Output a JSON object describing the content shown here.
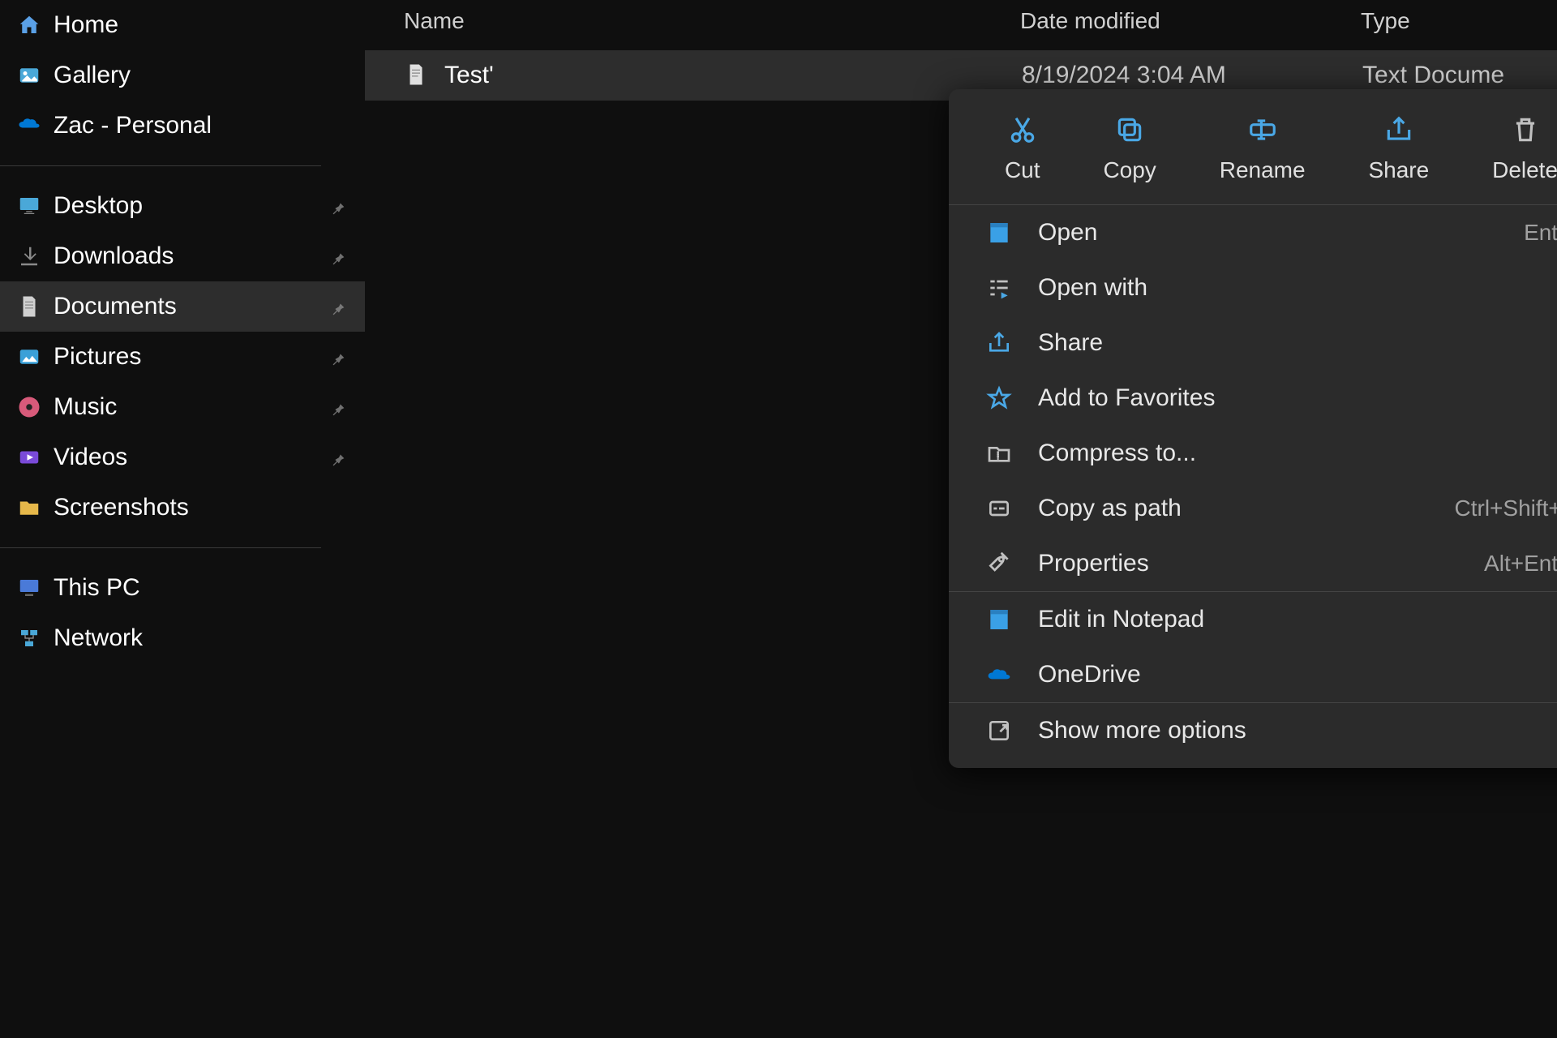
{
  "sidebar": {
    "top": [
      {
        "label": "Home",
        "icon": "home"
      },
      {
        "label": "Gallery",
        "icon": "gallery"
      },
      {
        "label": "Zac - Personal",
        "icon": "onedrive"
      }
    ],
    "pinned": [
      {
        "label": "Desktop",
        "icon": "desktop"
      },
      {
        "label": "Downloads",
        "icon": "downloads"
      },
      {
        "label": "Documents",
        "icon": "documents",
        "active": true
      },
      {
        "label": "Pictures",
        "icon": "pictures"
      },
      {
        "label": "Music",
        "icon": "music"
      },
      {
        "label": "Videos",
        "icon": "videos"
      },
      {
        "label": "Screenshots",
        "icon": "folder"
      }
    ],
    "bottom": [
      {
        "label": "This PC",
        "icon": "pc"
      },
      {
        "label": "Network",
        "icon": "network"
      }
    ]
  },
  "columns": {
    "name": "Name",
    "date": "Date modified",
    "type": "Type"
  },
  "file": {
    "name": "Test'",
    "date": "8/19/2024 3:04 AM",
    "type": "Text Docume"
  },
  "context": {
    "toolbar": [
      {
        "label": "Cut",
        "icon": "cut"
      },
      {
        "label": "Copy",
        "icon": "copy"
      },
      {
        "label": "Rename",
        "icon": "rename"
      },
      {
        "label": "Share",
        "icon": "share"
      },
      {
        "label": "Delete",
        "icon": "delete"
      }
    ],
    "groups": [
      [
        {
          "label": "Open",
          "icon": "open",
          "shortcut": "Enter"
        },
        {
          "label": "Open with",
          "icon": "openwith",
          "chevron": true
        },
        {
          "label": "Share",
          "icon": "share2"
        },
        {
          "label": "Add to Favorites",
          "icon": "star"
        },
        {
          "label": "Compress to...",
          "icon": "zip",
          "chevron": true
        },
        {
          "label": "Copy as path",
          "icon": "copypath",
          "shortcut": "Ctrl+Shift+C"
        },
        {
          "label": "Properties",
          "icon": "props",
          "shortcut": "Alt+Enter"
        }
      ],
      [
        {
          "label": "Edit in Notepad",
          "icon": "notepad"
        },
        {
          "label": "OneDrive",
          "icon": "onedrive",
          "chevron": true
        }
      ],
      [
        {
          "label": "Show more options",
          "icon": "more"
        }
      ]
    ]
  }
}
